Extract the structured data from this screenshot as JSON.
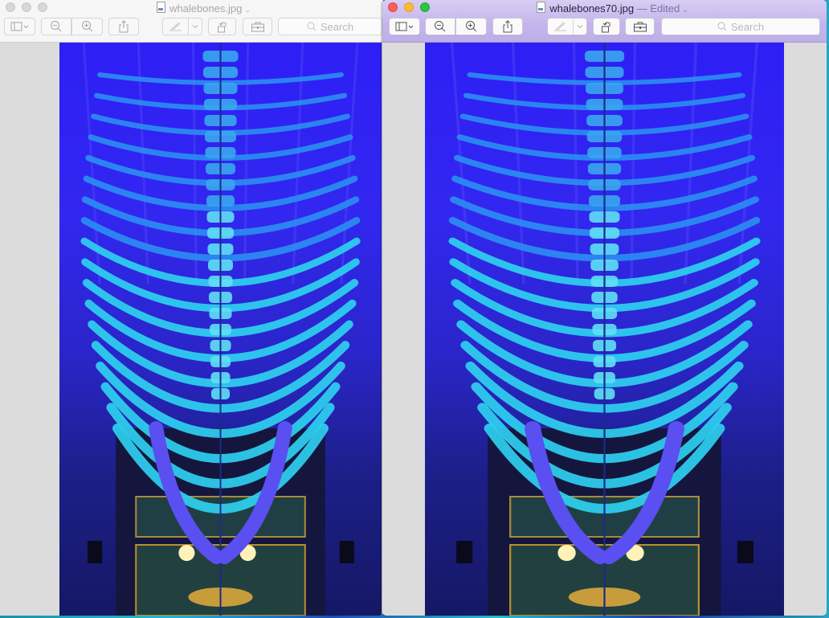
{
  "windows": [
    {
      "id": "left",
      "state": "inactive",
      "title": "whalebones.jpg",
      "edited_suffix": "",
      "toolbar": {
        "sidebar_button": "sidebar-toggle",
        "zoom_out": "zoom-out",
        "zoom_in": "zoom-in",
        "share": "share",
        "markup": "markup",
        "rotate": "rotate-left",
        "toolbox": "toolbox",
        "search_placeholder": "Search"
      },
      "image": {
        "subject": "Blue whale skeleton lit in blue light",
        "filename": "whalebones.jpg"
      }
    },
    {
      "id": "right",
      "state": "active",
      "title": "whalebones70.jpg",
      "edited_suffix": "— Edited",
      "toolbar": {
        "sidebar_button": "sidebar-toggle",
        "zoom_out": "zoom-out",
        "zoom_in": "zoom-in",
        "share": "share",
        "markup": "markup",
        "rotate": "rotate-left",
        "toolbox": "toolbox",
        "search_placeholder": "Search"
      },
      "image": {
        "subject": "Blue whale skeleton lit in blue light",
        "filename": "whalebones70.jpg"
      }
    }
  ],
  "colors": {
    "active_titlebar": "#c3b5ec",
    "inactive_titlebar": "#f6f6f6",
    "window_bg": "#dcdcdc",
    "close": "#fc5f57",
    "minimize": "#fdbc2e",
    "zoom": "#28c840",
    "bone_cyan": "#2fd0f0",
    "photo_blue": "#2d1ff5"
  }
}
